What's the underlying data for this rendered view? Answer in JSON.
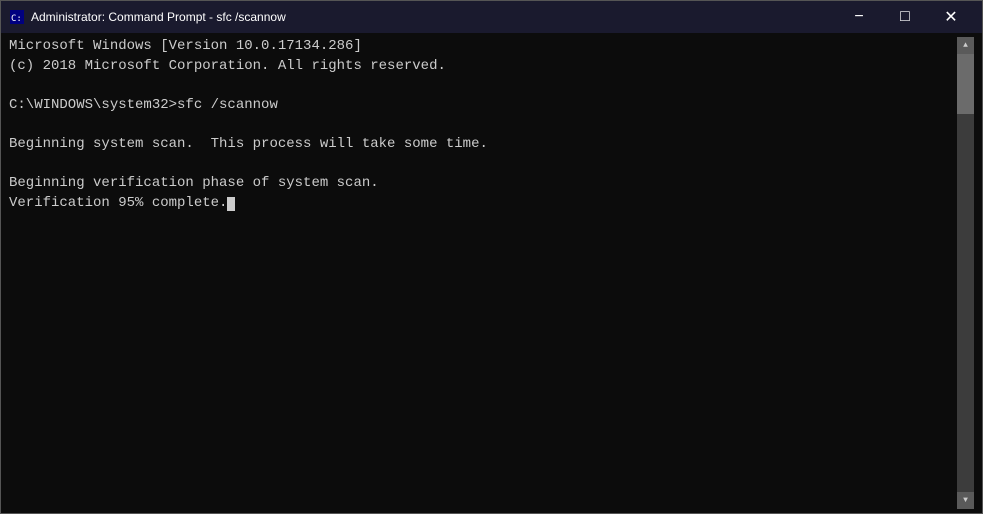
{
  "window": {
    "title": "Administrator: Command Prompt - sfc /scannow",
    "icon": "cmd-icon"
  },
  "controls": {
    "minimize": "−",
    "maximize": "□",
    "close": "✕"
  },
  "console": {
    "lines": [
      "Microsoft Windows [Version 10.0.17134.286]",
      "(c) 2018 Microsoft Corporation. All rights reserved.",
      "",
      "C:\\WINDOWS\\system32>sfc /scannow",
      "",
      "Beginning system scan.  This process will take some time.",
      "",
      "Beginning verification phase of system scan.",
      "Verification 95% complete."
    ]
  }
}
